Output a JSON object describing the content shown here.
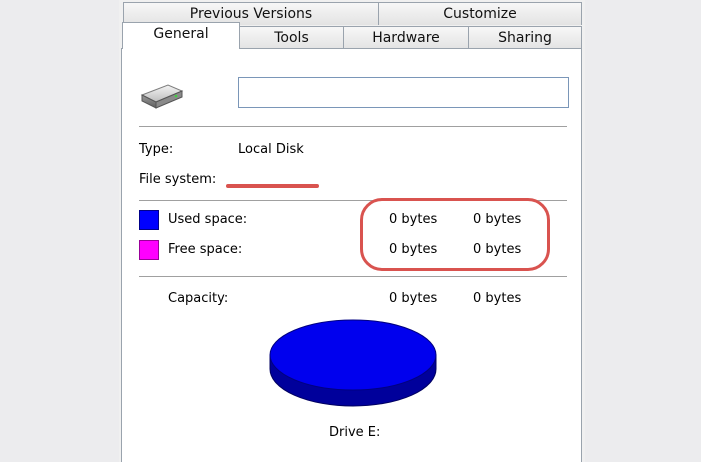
{
  "tabs_row1": [
    "Previous Versions",
    "Customize"
  ],
  "tabs_row2": [
    "General",
    "Tools",
    "Hardware",
    "Sharing"
  ],
  "general": {
    "name_value": "",
    "type_label": "Type:",
    "type_value": "Local Disk",
    "filesystem_label": "File system:",
    "filesystem_value": "",
    "used_label": "Used space:",
    "used_bytes": "0 bytes",
    "used_size": "0 bytes",
    "free_label": "Free space:",
    "free_bytes": "0 bytes",
    "free_size": "0 bytes",
    "capacity_label": "Capacity:",
    "capacity_bytes": "0 bytes",
    "capacity_size": "0 bytes",
    "drive_label": "Drive E:"
  },
  "colors": {
    "used": "#0000ff",
    "free": "#ff00ff",
    "annotation": "#d9534f"
  },
  "icons": {
    "drive": "hard-drive-icon"
  }
}
